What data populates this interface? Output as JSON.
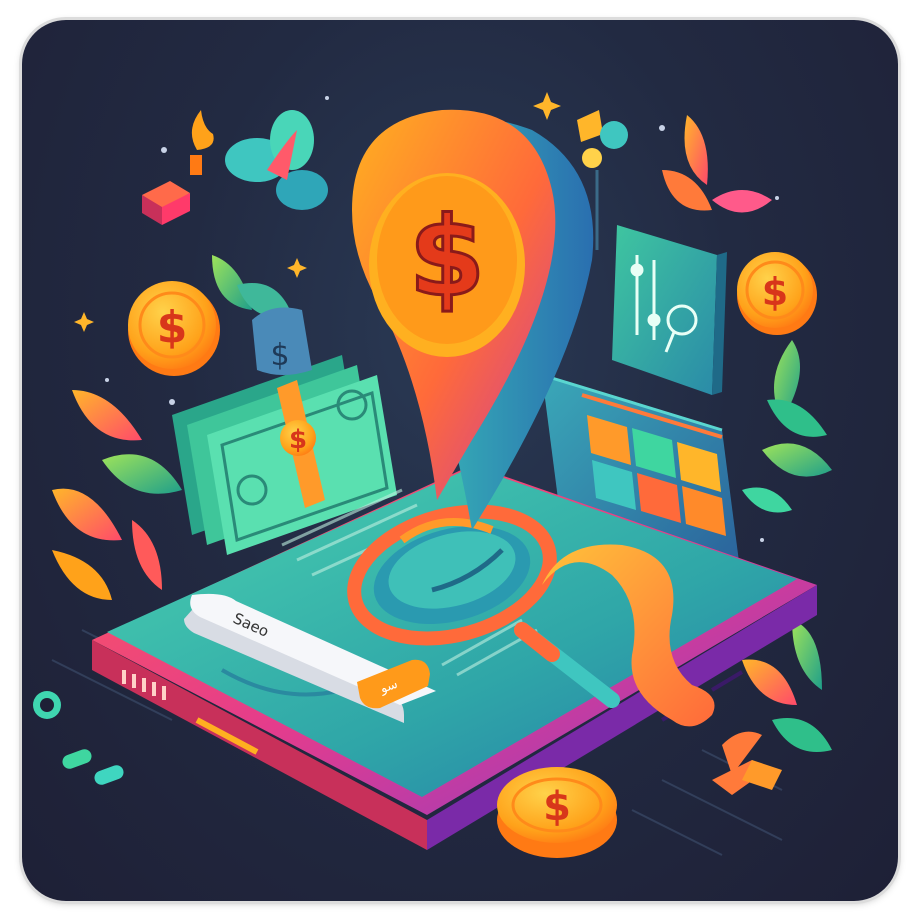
{
  "illustration": {
    "search_bar_text": "Saeo",
    "search_button_text": "سو"
  },
  "icons": {
    "currency_symbol": "$"
  },
  "colors": {
    "background": "#222a42",
    "pin_orange": "#ff9a1f",
    "pin_pink": "#e9407a",
    "phone_teal": "#3fb8a6",
    "coin_gold": "#ffb21a",
    "leaf_green": "#5cc08a"
  }
}
